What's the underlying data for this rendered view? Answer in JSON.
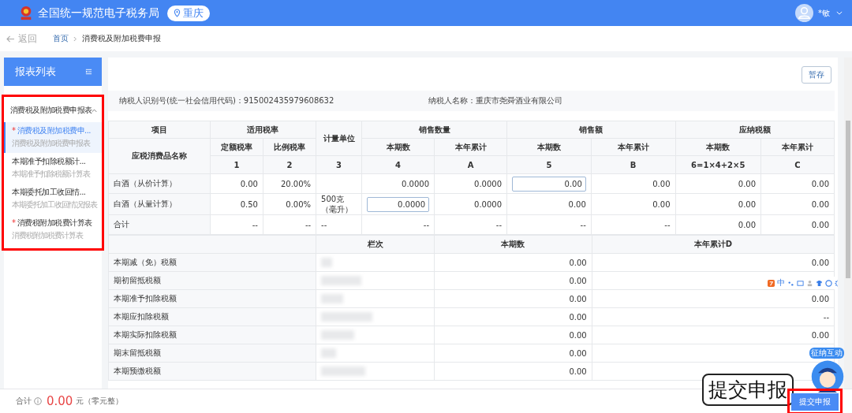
{
  "header": {
    "title": "全国统一规范电子税务局",
    "location": "重庆",
    "user": "*敏"
  },
  "breadcrumb": {
    "back": "返回",
    "items": [
      "首页",
      "消费税及附加税费申报"
    ]
  },
  "sidebar": {
    "title": "报表列表",
    "group": {
      "label": "消费税及附加税费申报表",
      "expanded": true
    },
    "items": [
      {
        "marker": "*",
        "title": "消费税及附加税费申...",
        "subtitle": "消费税及附加税费申报表",
        "selected": true
      },
      {
        "title": "本期准予扣除税额计...",
        "subtitle": "本期准予扣除税额计算表",
        "selected": false
      },
      {
        "title": "本期委托加工收回情...",
        "subtitle": "本期委托加工收回情况报表",
        "selected": false
      },
      {
        "marker": "*",
        "title": "消费税附加税费计算表",
        "subtitle": "消费税附加税费计算表",
        "selected": false
      }
    ]
  },
  "save_button": "暂存",
  "taxpayer": {
    "id_label": "纳税人识别号(统一社会信用代码)：915002435979608632",
    "name_label": "纳税人名称：重庆市尧舜酒业有限公司"
  },
  "table1": {
    "header_row1": [
      "项目",
      "适用税率",
      "计量单位",
      "销售数量",
      "销售额",
      "应纳税额"
    ],
    "header_row2": [
      "应税消费品名称",
      "定额税率",
      "比例税率",
      "本期数",
      "本年累计",
      "本期数",
      "本年累计",
      "本期数",
      "本年累计"
    ],
    "header_row3": [
      "1",
      "2",
      "3",
      "4",
      "A",
      "5",
      "B",
      "6=1×4+2×5",
      "C"
    ],
    "rows": [
      {
        "cells": [
          {
            "text": "白酒（从价计算）"
          },
          {
            "text": "0.00"
          },
          {
            "text": "20.00%"
          },
          {
            "text": ""
          },
          {
            "text": "0.0000"
          },
          {
            "text": "0.0000"
          },
          {
            "text": "0.00",
            "kind": "input"
          },
          {
            "text": "0.00"
          },
          {
            "text": "0.00"
          },
          {
            "text": "0.00"
          }
        ]
      },
      {
        "cells": [
          {
            "text": "白酒（从量计算）"
          },
          {
            "text": "0.50"
          },
          {
            "text": "0.00%"
          },
          {
            "text": "500克（毫升）"
          },
          {
            "text": "0.0000",
            "kind": "input"
          },
          {
            "text": "0.0000"
          },
          {
            "text": "0.00"
          },
          {
            "text": "0.00"
          },
          {
            "text": "0.00"
          },
          {
            "text": "0.00"
          }
        ]
      },
      {
        "cells": [
          {
            "text": "合计"
          },
          {
            "text": "--"
          },
          {
            "text": "--"
          },
          {
            "text": "--"
          },
          {
            "text": "--"
          },
          {
            "text": "--"
          },
          {
            "text": "--"
          },
          {
            "text": "--"
          },
          {
            "text": "0.00"
          },
          {
            "text": "0.00"
          }
        ]
      }
    ]
  },
  "table2": {
    "columns": [
      "栏次",
      "本期数",
      "本年累计D"
    ],
    "rows": [
      {
        "label": "本期减（免）税额",
        "current": "0.00",
        "ytd": "0.00"
      },
      {
        "label": "期初留抵税额",
        "current": "0.00"
      },
      {
        "label": "本期准予扣除税额",
        "current": "0.00",
        "ytd": "0.00"
      },
      {
        "label": "本期应扣除税额",
        "current": "0.00",
        "ytd": "--"
      },
      {
        "label": "本期实际扣除税额",
        "current": "0.00",
        "ytd": "0.00"
      },
      {
        "label": "期末留抵税额",
        "current": "0.00"
      },
      {
        "label": "本期预缴税额",
        "current": "0.00"
      }
    ]
  },
  "footer": {
    "total_label": "合计",
    "amount": "0.00",
    "unit": "元（零元整）",
    "submit": "提交申报"
  },
  "ime_toolbar": {
    "label": "中"
  },
  "callout": "提交申报",
  "mascot": "征纳互动"
}
